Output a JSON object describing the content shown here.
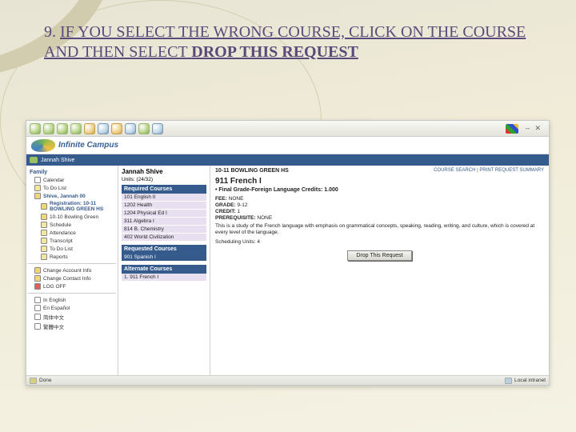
{
  "instruction": {
    "number": "9.",
    "prefix": "IF YOU SELECT THE WRONG COURSE, CLICK ON THE COURSE AND THEN SELECT ",
    "bold": "DROP THIS REQUEST"
  },
  "toolbar": {
    "winctrl": "–  ✕"
  },
  "logo": {
    "text": "Infinite Campus"
  },
  "tabbar": {
    "user": "Jannah Shive"
  },
  "sidebar": {
    "header1": "Family",
    "cal": "Calendar",
    "todo": "To Do List",
    "student": "Shive, Jannah 00",
    "reg": "Registration: 10-11 BOWLING GREEN HS",
    "sched10": "10-10 Bowling Green",
    "sched": "Schedule",
    "att": "Attendance",
    "trans": "Transcript",
    "todo2": "To Do List",
    "reports": "Reports",
    "chg": "Change Account Info",
    "contact": "Change Contact Info",
    "logoff": "LOG OFF",
    "lang1": "In English",
    "lang2": "En Español",
    "lang3": "简体中文",
    "lang4": "繁體中文"
  },
  "mid": {
    "name": "Jannah Shive",
    "units": "Units: (24/32)",
    "required_h": "Required Courses",
    "req": [
      "101 English II",
      "1202 Health",
      "1204 Physical Ed I",
      "311 Algebra I",
      "814 B. Chemistry",
      "402 World Civilization"
    ],
    "requested_h": "Requested Courses",
    "requested": [
      "901 Spanish I"
    ],
    "alt_h": "Alternate Courses",
    "alt": [
      "1. 911 French I"
    ]
  },
  "detail": {
    "school": "10-11 BOWLING GREEN HS",
    "links": "COURSE SEARCH  |  PRINT REQUEST SUMMARY",
    "course": "911 French I",
    "subtitle": "•  Final Grade-Foreign Language Credits: 1.000",
    "fee_k": "FEE:",
    "fee_v": "NONE",
    "grade_k": "GRADE:",
    "grade_v": "9-12",
    "credit_k": "CREDIT:",
    "credit_v": "1",
    "prereq_k": "PREREQUISITE:",
    "prereq_v": "NONE",
    "desc": "This is a study of the French language with emphasis on grammatical concepts, speaking, reading, writing, and culture, which is covered at every level of the language.",
    "sched_units": "Scheduling Units: 4",
    "drop_label": "Drop This Request"
  },
  "status": {
    "left": "Done",
    "right": "Local intranet"
  }
}
